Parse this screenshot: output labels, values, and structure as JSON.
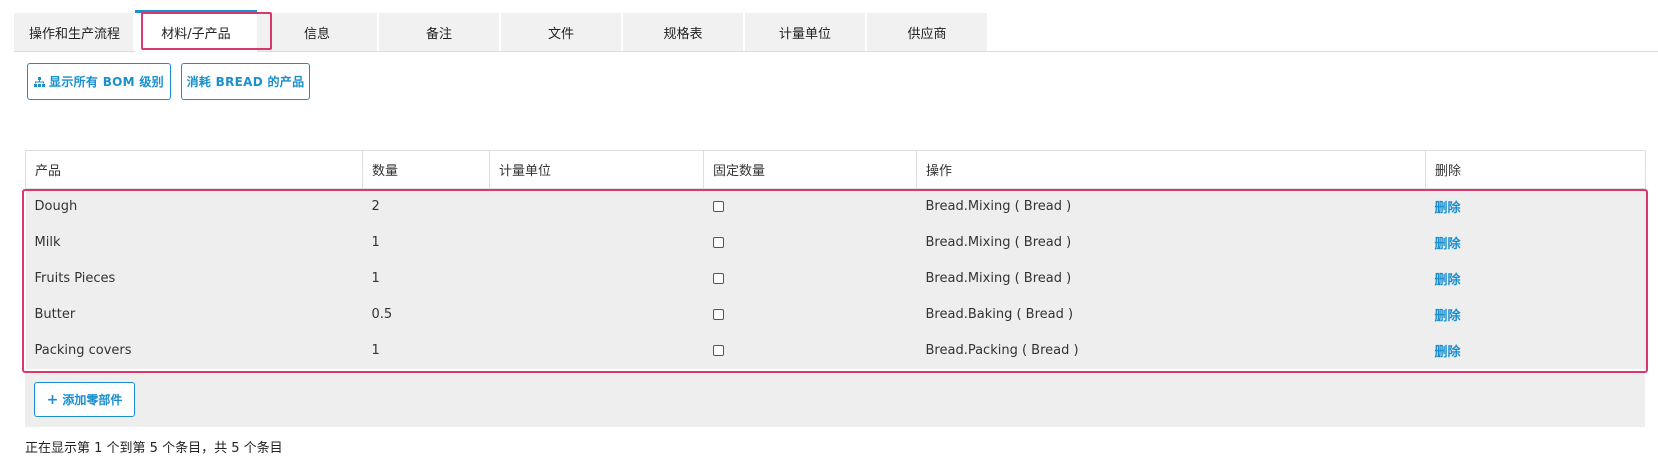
{
  "tabs": [
    {
      "label": "操作和生产流程"
    },
    {
      "label": "材料/子产品"
    },
    {
      "label": "信息"
    },
    {
      "label": "备注"
    },
    {
      "label": "文件"
    },
    {
      "label": "规格表"
    },
    {
      "label": "计量单位"
    },
    {
      "label": "供应商"
    }
  ],
  "active_tab": "材料/子产品",
  "buttons": {
    "show_bom": "显示所有 BOM 级别",
    "consume": "消耗 BREAD 的产品",
    "add_component": "添加零部件"
  },
  "table": {
    "headers": [
      "产品",
      "数量",
      "计量单位",
      "固定数量",
      "操作",
      "删除"
    ],
    "rows": [
      {
        "product": "Dough",
        "qty": "2",
        "uom": "",
        "fixed": false,
        "operation": "Bread.Mixing ( Bread )",
        "delete": "删除"
      },
      {
        "product": "Milk",
        "qty": "1",
        "uom": "",
        "fixed": false,
        "operation": "Bread.Mixing ( Bread )",
        "delete": "删除"
      },
      {
        "product": "Fruits Pieces",
        "qty": "1",
        "uom": "",
        "fixed": false,
        "operation": "Bread.Mixing ( Bread )",
        "delete": "删除"
      },
      {
        "product": "Butter",
        "qty": "0.5",
        "uom": "",
        "fixed": false,
        "operation": "Bread.Baking ( Bread )",
        "delete": "删除"
      },
      {
        "product": "Packing covers",
        "qty": "1",
        "uom": "",
        "fixed": false,
        "operation": "Bread.Packing ( Bread )",
        "delete": "删除"
      }
    ]
  },
  "info_text": "正在显示第 1 个到第 5 个条目，共 5 个条目",
  "colors": {
    "accent": "#1a8fce",
    "highlight": "#d9386b",
    "row_bg": "#eeeeee"
  },
  "icons": {
    "show_bom": "sitemap-icon",
    "add_component": "plus-icon"
  }
}
